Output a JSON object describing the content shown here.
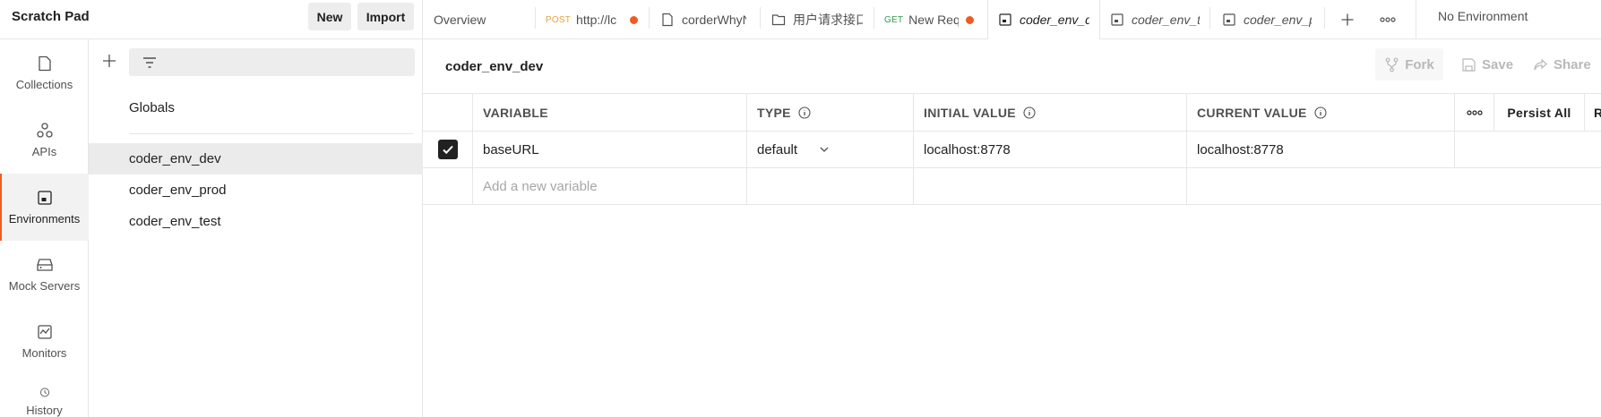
{
  "workspace": {
    "title": "Scratch Pad",
    "new_label": "New",
    "import_label": "Import"
  },
  "tabs": [
    {
      "label": "Overview"
    },
    {
      "method": "POST",
      "label": "http://lc",
      "unsaved": true
    },
    {
      "label": "corderWhyN"
    },
    {
      "label": "用户请求接口"
    },
    {
      "method": "GET",
      "label": "New Req",
      "unsaved": true
    },
    {
      "label": "coder_env_d",
      "active": true
    },
    {
      "label": "coder_env_t"
    },
    {
      "label": "coder_env_p"
    }
  ],
  "environment_selector": {
    "label": "No Environment"
  },
  "rail": [
    {
      "label": "Collections",
      "icon": "collections-icon"
    },
    {
      "label": "APIs",
      "icon": "apis-icon"
    },
    {
      "label": "Environments",
      "icon": "environments-icon",
      "active": true
    },
    {
      "label": "Mock Servers",
      "icon": "mock-servers-icon"
    },
    {
      "label": "Monitors",
      "icon": "monitors-icon"
    },
    {
      "label": "History",
      "icon": "history-icon"
    }
  ],
  "sidebar": {
    "search_placeholder": "",
    "globals_label": "Globals",
    "items": [
      {
        "label": "coder_env_dev",
        "active": true
      },
      {
        "label": "coder_env_prod"
      },
      {
        "label": "coder_env_test"
      }
    ]
  },
  "main": {
    "title": "coder_env_dev",
    "fork_label": "Fork",
    "save_label": "Save",
    "share_label": "Share",
    "table": {
      "headers": {
        "variable": "VARIABLE",
        "type": "TYPE",
        "initial": "INITIAL VALUE",
        "current": "CURRENT VALUE",
        "persist_all": "Persist All",
        "reset": "R"
      },
      "rows": [
        {
          "enabled": true,
          "variable": "baseURL",
          "type": "default",
          "initial": "localhost:8778",
          "current": "localhost:8778"
        }
      ],
      "new_variable_placeholder": "Add a new variable"
    }
  },
  "colors": {
    "accent": "#ef5b25",
    "text": "#212121",
    "muted": "#505050",
    "border": "#e6e6e6"
  }
}
